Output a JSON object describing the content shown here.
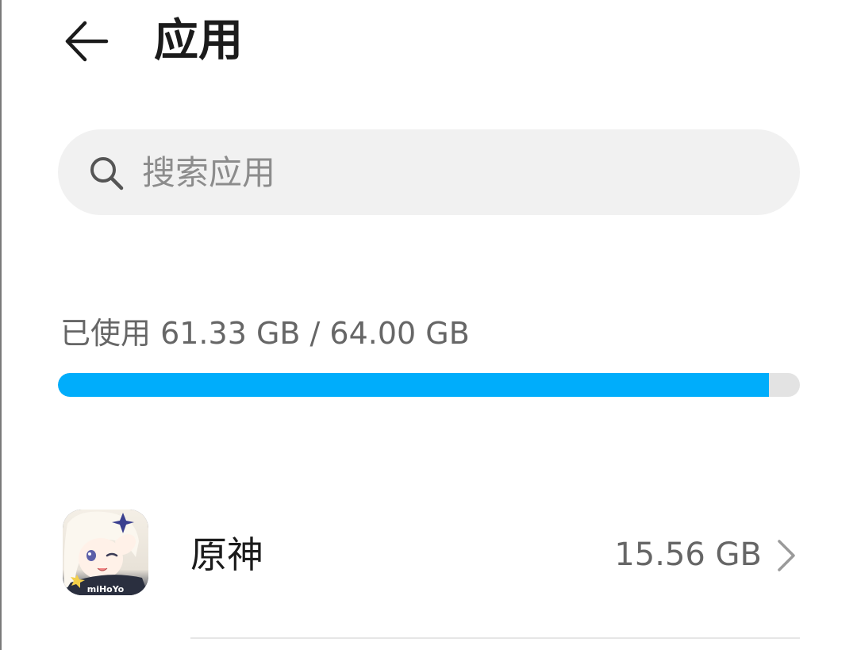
{
  "header": {
    "title": "应用",
    "back_icon": "arrow-left-icon"
  },
  "search": {
    "placeholder": "搜索应用",
    "value": "",
    "icon": "search-icon"
  },
  "storage": {
    "summary": "已使用 61.33 GB / 64.00 GB",
    "used_gb": 61.33,
    "total_gb": 64.0,
    "bar_color": "#00adfb",
    "track_color": "#e3e3e3"
  },
  "apps": [
    {
      "name": "原神",
      "size": "15.56 GB",
      "icon_brand_text": "miHoYo",
      "chevron_icon": "chevron-right-icon"
    }
  ]
}
